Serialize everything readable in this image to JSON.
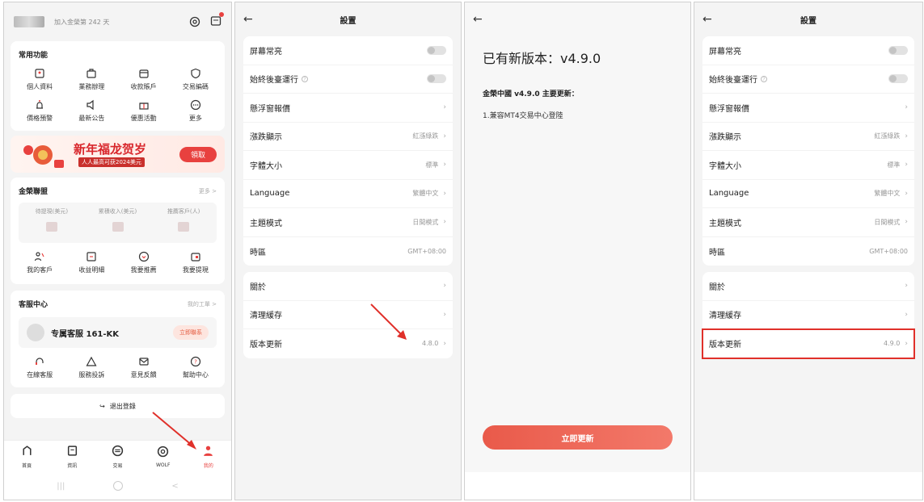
{
  "p1": {
    "joined": "加入金榮第 242 天",
    "common_title": "常用功能",
    "common": [
      {
        "label": "個人資料",
        "icon": "id-card-icon"
      },
      {
        "label": "業務辦理",
        "icon": "briefcase-icon"
      },
      {
        "label": "收款賬戶",
        "icon": "wallet-icon"
      },
      {
        "label": "交易編碼",
        "icon": "shield-icon"
      },
      {
        "label": "價格預警",
        "icon": "alarm-icon"
      },
      {
        "label": "最新公告",
        "icon": "speaker-icon"
      },
      {
        "label": "優惠活動",
        "icon": "gift-icon"
      },
      {
        "label": "更多",
        "icon": "more-icon"
      }
    ],
    "banner": {
      "title": "新年福龙贺岁",
      "sub": "人人最高可获2024美元",
      "claim": "領取"
    },
    "alliance": {
      "title": "金榮聯盟",
      "more": "更多 >",
      "stats": [
        "待提現(美元)",
        "累積收入(美元)",
        "推薦客戶(人)"
      ],
      "items": [
        {
          "label": "我的客戶",
          "icon": "people-icon"
        },
        {
          "label": "收益明細",
          "icon": "ledger-icon"
        },
        {
          "label": "我要推薦",
          "icon": "recommend-icon"
        },
        {
          "label": "我要提現",
          "icon": "withdraw-icon"
        }
      ]
    },
    "service": {
      "title": "客服中心",
      "more": "我的工單 >",
      "agent": "专属客服 161-KK",
      "contact": "立即聯系",
      "items": [
        {
          "label": "在線客服",
          "icon": "headset-icon"
        },
        {
          "label": "服務投訴",
          "icon": "warning-icon"
        },
        {
          "label": "意見反饋",
          "icon": "mail-icon"
        },
        {
          "label": "幫助中心",
          "icon": "help-icon"
        }
      ]
    },
    "logout": "退出登錄",
    "tabs": [
      {
        "label": "首頁",
        "icon": "home-icon"
      },
      {
        "label": "資訊",
        "icon": "news-icon"
      },
      {
        "label": "交易",
        "icon": "trade-icon"
      },
      {
        "label": "WOLF",
        "icon": "wolf-icon"
      },
      {
        "label": "我的",
        "icon": "profile-icon"
      }
    ]
  },
  "settings": {
    "title": "設置",
    "group1": [
      {
        "label": "屏幕常亮",
        "type": "toggle"
      },
      {
        "label": "始終後臺運行",
        "type": "toggle-help"
      },
      {
        "label": "懸浮窗報價",
        "type": "nav"
      },
      {
        "label": "漲跌顯示",
        "value": "紅漲綠跌",
        "type": "nav"
      },
      {
        "label": "字體大小",
        "value": "標準",
        "type": "nav"
      },
      {
        "label": "Language",
        "value": "繁體中文",
        "type": "nav"
      },
      {
        "label": "主題模式",
        "value": "日間模式",
        "type": "nav"
      },
      {
        "label": "時區",
        "value": "GMT+08:00",
        "type": "value"
      }
    ],
    "group2": [
      {
        "label": "關於",
        "value": ""
      },
      {
        "label": "清理緩存",
        "value": ""
      },
      {
        "label": "版本更新",
        "value": "4.8.0"
      }
    ],
    "group2_after": [
      {
        "label": "關於",
        "value": ""
      },
      {
        "label": "清理緩存",
        "value": ""
      },
      {
        "label": "版本更新",
        "value": "4.9.0"
      }
    ]
  },
  "update": {
    "title": "已有新版本：v4.9.0",
    "subtitle": "金榮中國 v4.9.0 主要更新：",
    "note": "1.兼容MT4交易中心登陸",
    "button": "立即更新"
  }
}
